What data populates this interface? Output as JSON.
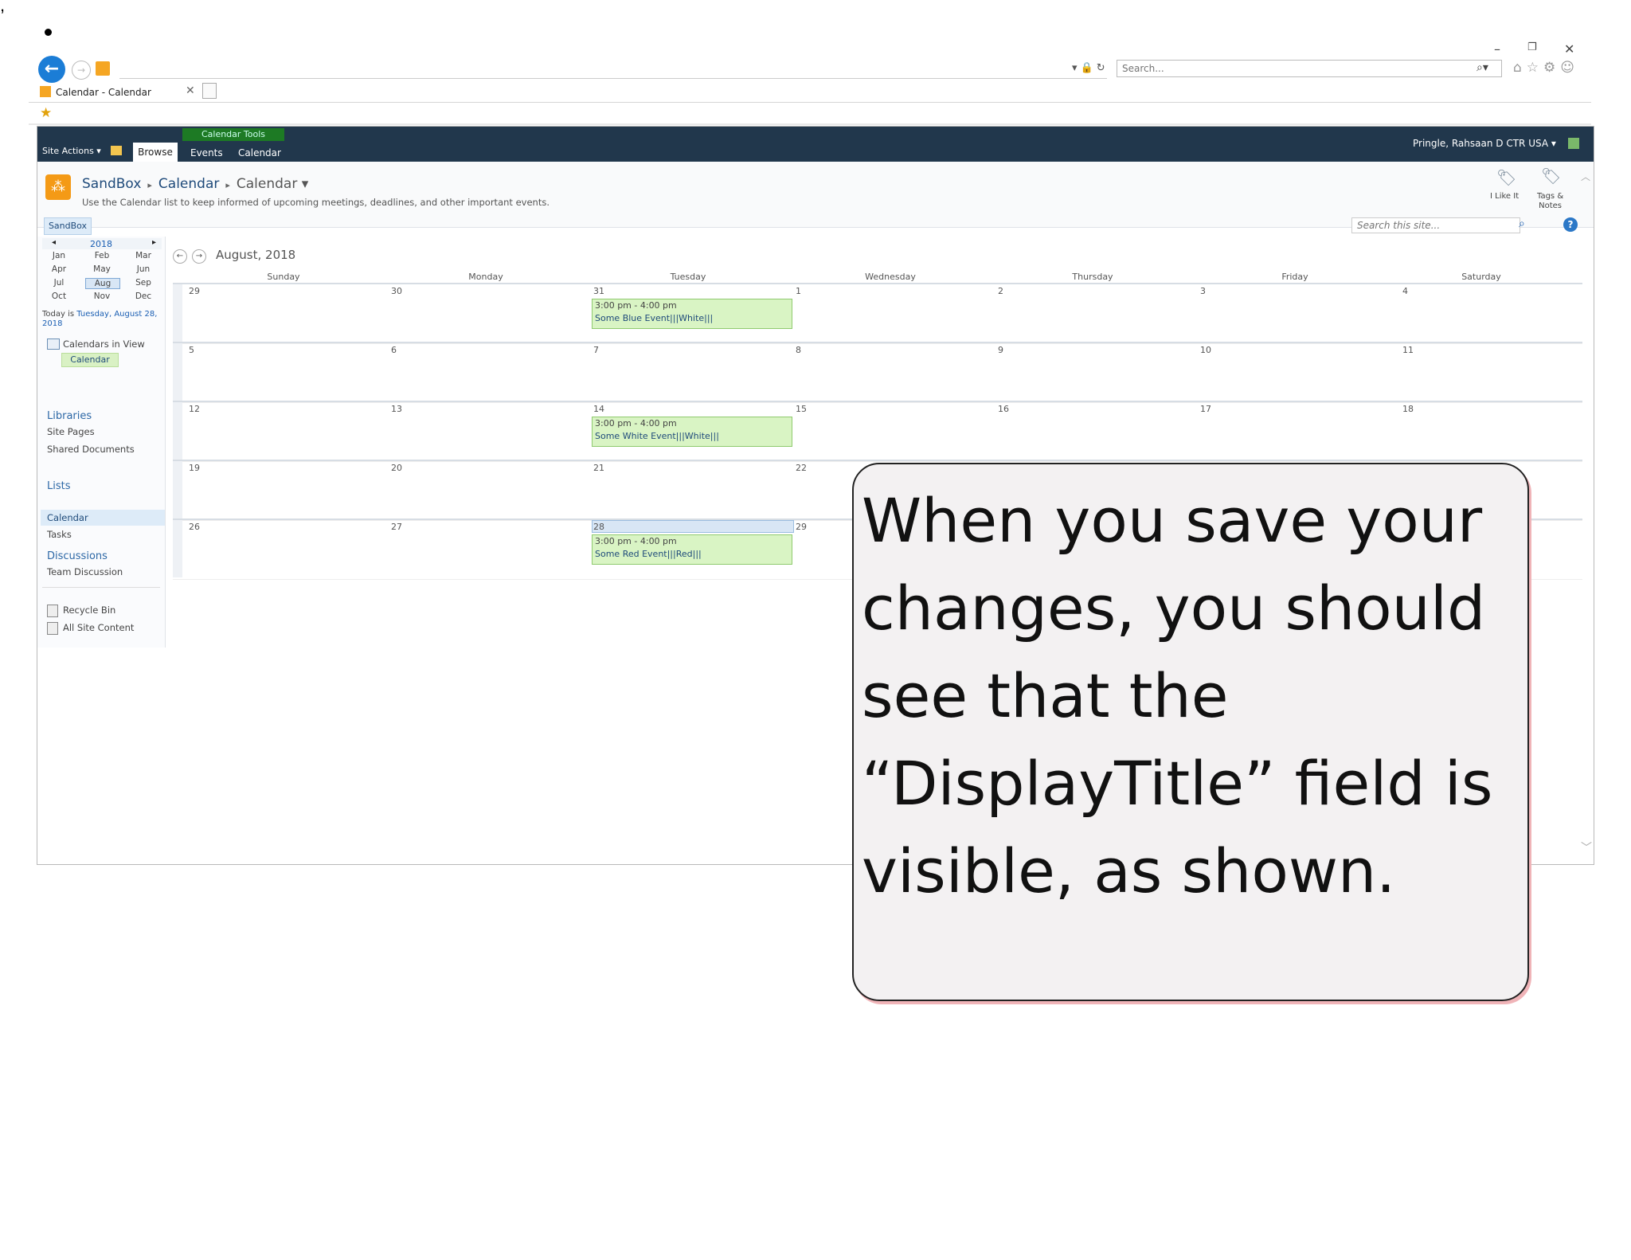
{
  "browser": {
    "search_placeholder": "Search...",
    "tab_title": "Calendar - Calendar",
    "window_controls": [
      "–",
      "❐",
      "✕"
    ]
  },
  "ribbon": {
    "site_actions": "Site Actions ▾",
    "calendar_tools": "Calendar Tools",
    "tabs": [
      "Browse",
      "Events",
      "Calendar"
    ],
    "user": "Pringle, Rahsaan D CTR USA ▾"
  },
  "title_area": {
    "breadcrumb": [
      "SandBox",
      "Calendar",
      "Calendar ▾"
    ],
    "description": "Use the Calendar list to keep informed of upcoming meetings, deadlines, and other important events.",
    "like_label": "I Like It",
    "tags_label": "Tags &\nNotes",
    "sandbox_tab": "SandBox",
    "search_placeholder": "Search this site..."
  },
  "left_nav": {
    "year": "2018",
    "months": [
      "Jan",
      "Feb",
      "Mar",
      "Apr",
      "May",
      "Jun",
      "Jul",
      "Aug",
      "Sep",
      "Oct",
      "Nov",
      "Dec"
    ],
    "selected_month": "Aug",
    "today_prefix": "Today is ",
    "today_value": "Tuesday, August 28, 2018",
    "calendars_in_view": "Calendars in View",
    "calendar_item": "Calendar",
    "libraries": {
      "heading": "Libraries",
      "items": [
        "Site Pages",
        "Shared Documents"
      ]
    },
    "lists": {
      "heading": "Lists",
      "items": [
        "Calendar",
        "Tasks"
      ]
    },
    "discussions": {
      "heading": "Discussions",
      "items": [
        "Team Discussion"
      ]
    },
    "recycle_bin": "Recycle Bin",
    "all_site_content": "All Site Content"
  },
  "calendar": {
    "title": "August, 2018",
    "day_names": [
      "Sunday",
      "Monday",
      "Tuesday",
      "Wednesday",
      "Thursday",
      "Friday",
      "Saturday"
    ],
    "weeks": [
      [
        "29",
        "30",
        "31",
        "1",
        "2",
        "3",
        "4"
      ],
      [
        "5",
        "6",
        "7",
        "8",
        "9",
        "10",
        "11"
      ],
      [
        "12",
        "13",
        "14",
        "15",
        "16",
        "17",
        "18"
      ],
      [
        "19",
        "20",
        "21",
        "22",
        "",
        "",
        ""
      ],
      [
        "26",
        "27",
        "28",
        "29",
        "",
        "",
        ""
      ]
    ],
    "events": [
      {
        "time": "3:00 pm - 4:00 pm",
        "title": "Some Blue Event|||White|||"
      },
      {
        "time": "3:00 pm - 4:00 pm",
        "title": "Some White Event|||White|||"
      },
      {
        "time": "3:00 pm - 4:00 pm",
        "title": "Some Red Event|||Red|||"
      }
    ]
  },
  "callout": {
    "text": "When you save your changes, you should see that the “DisplayTitle” field is visible, as shown."
  }
}
